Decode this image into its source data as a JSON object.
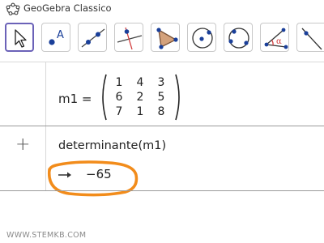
{
  "app": {
    "title": "GeoGebra Classico"
  },
  "toolbar": {
    "tools": [
      {
        "name": "move-tool"
      },
      {
        "name": "point-tool",
        "label": "A"
      },
      {
        "name": "line-tool"
      },
      {
        "name": "perpendicular-line-tool"
      },
      {
        "name": "polygon-tool"
      },
      {
        "name": "circle-center-point-tool"
      },
      {
        "name": "circle-through-three-points-tool"
      },
      {
        "name": "angle-tool",
        "label": "α"
      },
      {
        "name": "reflect-tool"
      }
    ]
  },
  "algebra": {
    "matrix_row": {
      "label": "m1 =",
      "values": [
        [
          1,
          4,
          3
        ],
        [
          6,
          2,
          5
        ],
        [
          7,
          1,
          8
        ]
      ]
    },
    "input_row": {
      "add_icon": "+",
      "expression": "determinante(m1)",
      "result_prefix_icon": "arrow-right",
      "result": "−65"
    }
  },
  "colors": {
    "selected_tool_border": "#6b62b8",
    "highlight": "#f28c1b",
    "point_blue": "#1a3f99",
    "polygon_fill": "#d4a27c"
  },
  "watermark": "WWW.STEMKB.COM"
}
